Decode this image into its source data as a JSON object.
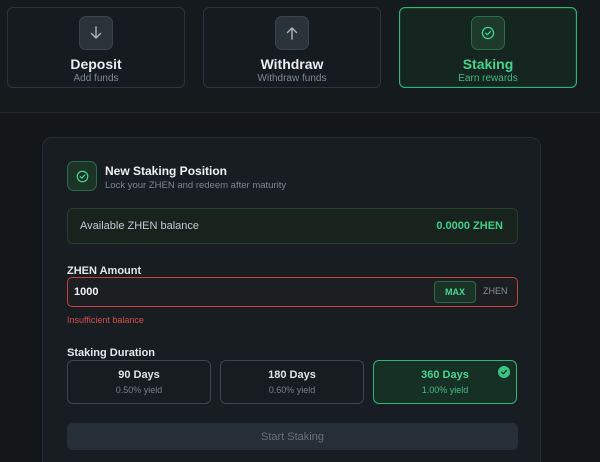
{
  "tabs": [
    {
      "title": "Deposit",
      "subtitle": "Add funds",
      "icon": "arrow-down-icon"
    },
    {
      "title": "Withdraw",
      "subtitle": "Withdraw funds",
      "icon": "arrow-up-icon"
    },
    {
      "title": "Staking",
      "subtitle": "Earn rewards",
      "icon": "check-circle-icon"
    }
  ],
  "active_tab": "Staking",
  "panel": {
    "title": "New Staking Position",
    "subtitle": "Lock your ZHEN and redeem after maturity",
    "balance_label": "Available ZHEN balance",
    "balance_value": "0.0000 ZHEN",
    "amount_label": "ZHEN Amount",
    "amount_value": "1000",
    "max_label": "MAX",
    "unit": "ZHEN",
    "error": "Insufficient balance",
    "duration_label": "Staking Duration",
    "durations": [
      {
        "days": "90 Days",
        "yield": "0.50% yield"
      },
      {
        "days": "180 Days",
        "yield": "0.60% yield"
      },
      {
        "days": "360 Days",
        "yield": "1.00% yield"
      }
    ],
    "selected_duration": "360 Days",
    "start_button": "Start Staking"
  },
  "colors": {
    "accent": "#2fb57b",
    "error": "#c94040",
    "background": "#13171a"
  }
}
